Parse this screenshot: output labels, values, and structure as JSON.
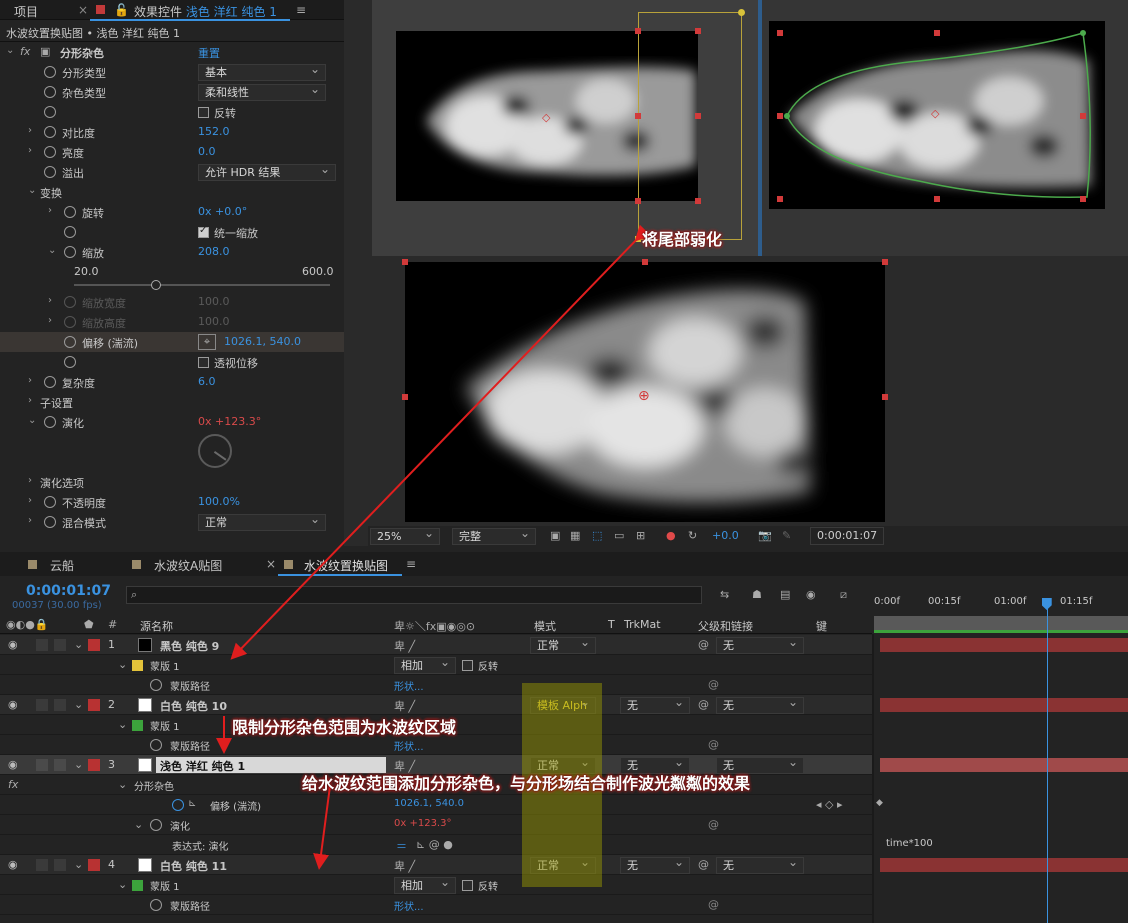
{
  "effect_controls": {
    "tab_project": "项目",
    "tab_effect_prefix": "效果控件",
    "tab_effect_layer": "浅色 洋红 纯色 1",
    "breadcrumb": "水波纹置换贴图 • 浅色 洋红 纯色 1",
    "effect_name": "分形杂色",
    "reset": "重置",
    "fractal_type_label": "分形类型",
    "fractal_type_value": "基本",
    "noise_type_label": "杂色类型",
    "noise_type_value": "柔和线性",
    "invert_label": "反转",
    "contrast_label": "对比度",
    "contrast_value": "152.0",
    "brightness_label": "亮度",
    "brightness_value": "0.0",
    "overflow_label": "溢出",
    "overflow_value": "允许 HDR 结果",
    "transform_label": "变换",
    "rotation_label": "旋转",
    "rotation_value_prefix": "0x",
    "rotation_value": "+0.0°",
    "uniform_scale_label": "统一缩放",
    "scale_label": "缩放",
    "scale_value": "208.0",
    "scale_min": "20.0",
    "scale_max": "600.0",
    "scale_slider_fraction": 0.32,
    "scale_width_label": "缩放宽度",
    "scale_width_value": "100.0",
    "scale_height_label": "缩放高度",
    "scale_height_value": "100.0",
    "offset_label": "偏移 (湍流)",
    "offset_value": "1026.1, 540.0",
    "perspective_label": "透视位移",
    "complexity_label": "复杂度",
    "complexity_value": "6.0",
    "subsettings_label": "子设置",
    "evolution_label": "演化",
    "evolution_value_prefix": "0x",
    "evolution_value": "+123.3°",
    "evolution_options_label": "演化选项",
    "opacity_label": "不透明度",
    "opacity_value": "100.0%",
    "blend_label": "混合模式",
    "blend_value": "正常"
  },
  "viewer": {
    "zoom": "25%",
    "resolution": "完整",
    "exposure": "+0.0",
    "timecode": "0:00:01:07"
  },
  "timeline": {
    "tabs": [
      "云船",
      "水波纹A贴图",
      "水波纹置换贴图"
    ],
    "timecode": "0:00:01:07",
    "frame_info": "00037 (30.00 fps)",
    "search_placeholder": "",
    "col_source": "源名称",
    "col_mode": "模式",
    "col_t": "T",
    "col_trkmat": "TrkMat",
    "col_parent": "父级和链接",
    "col_key": "键",
    "ruler": [
      "0:00f",
      "00:15f",
      "01:00f",
      "01:15f"
    ],
    "playhead_fraction": 0.68,
    "rows": {
      "l1_num": "1",
      "l1_name": "黑色 纯色 9",
      "l1_mode": "正常",
      "l1_parent": "无",
      "mask_label": "蒙版 1",
      "mask_mode": "相加",
      "invert": "反转",
      "mask_path": "蒙版路径",
      "shape": "形状...",
      "l2_num": "2",
      "l2_name": "白色 纯色 10",
      "l2_mode": "模板 Alph",
      "l2_trk": "无",
      "l2_parent": "无",
      "l3_num": "3",
      "l3_name": "浅色 洋红 纯色 1",
      "l3_mode": "正常",
      "l3_trk": "无",
      "l3_parent": "无",
      "fx_label": "分形杂色",
      "offset_label": "偏移 (湍流)",
      "offset_value": "1026.1, 540.0",
      "evolution_label": "演化",
      "evolution_value": "0x +123.3°",
      "expr_label": "表达式: 演化",
      "expr_value": "time*100",
      "l4_num": "4",
      "l4_name": "白色 纯色 11",
      "l4_mode": "正常",
      "l4_trk": "无",
      "l4_parent": "无"
    }
  },
  "annotations": {
    "weaken_tail": "将尾部弱化",
    "limit_range": "限制分形杂色范围为水波纹区域",
    "add_noise": "给水波纹范围添加分形杂色，与分形场结合制作波光粼粼的效果"
  },
  "colors": {
    "accent": "#3a92e0",
    "label_red": "#b83232",
    "mask_yellow": "#e2c23a",
    "mask_green": "#3ca33c",
    "keyframe_bar": "#8a3333"
  }
}
